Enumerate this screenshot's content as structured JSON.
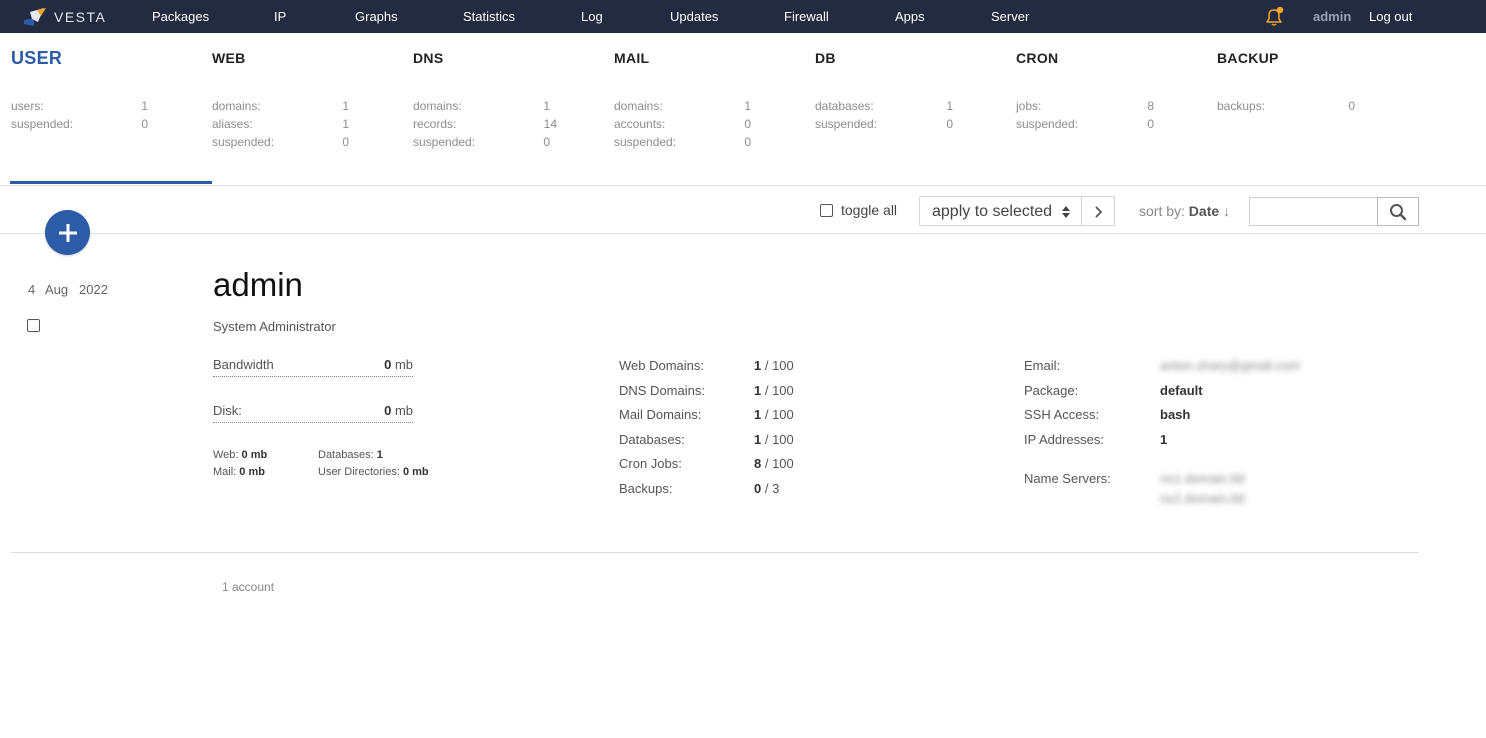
{
  "nav": {
    "logo": "VESTA",
    "items": [
      "Packages",
      "IP",
      "Graphs",
      "Statistics",
      "Log",
      "Updates",
      "Firewall",
      "Apps",
      "Server"
    ],
    "user": "admin",
    "logout": "Log out"
  },
  "stats": [
    {
      "title": "USER",
      "rows": [
        {
          "label": "users:",
          "value": "1"
        },
        {
          "label": "suspended:",
          "value": "0"
        }
      ]
    },
    {
      "title": "WEB",
      "rows": [
        {
          "label": "domains:",
          "value": "1"
        },
        {
          "label": "aliases:",
          "value": "1"
        },
        {
          "label": "suspended:",
          "value": "0"
        }
      ]
    },
    {
      "title": "DNS",
      "rows": [
        {
          "label": "domains:",
          "value": "1"
        },
        {
          "label": "records:",
          "value": "14"
        },
        {
          "label": "suspended:",
          "value": "0"
        }
      ]
    },
    {
      "title": "MAIL",
      "rows": [
        {
          "label": "domains:",
          "value": "1"
        },
        {
          "label": "accounts:",
          "value": "0"
        },
        {
          "label": "suspended:",
          "value": "0"
        }
      ]
    },
    {
      "title": "DB",
      "rows": [
        {
          "label": "databases:",
          "value": "1"
        },
        {
          "label": "suspended:",
          "value": "0"
        }
      ]
    },
    {
      "title": "CRON",
      "rows": [
        {
          "label": "jobs:",
          "value": "8"
        },
        {
          "label": "suspended:",
          "value": "0"
        }
      ]
    },
    {
      "title": "BACKUP",
      "rows": [
        {
          "label": "backups:",
          "value": "0"
        }
      ]
    }
  ],
  "toolbar": {
    "toggle_all": "toggle all",
    "apply": "apply to selected",
    "sort_prefix": "sort by:",
    "sort_field": "Date",
    "sort_arrow": "↓"
  },
  "record": {
    "day": "4",
    "month": "Aug",
    "year": "2022",
    "name": "admin",
    "role": "System Administrator",
    "bandwidth_label": "Bandwidth",
    "bandwidth_value": "0",
    "disk_label": "Disk:",
    "disk_value": "0",
    "unit": "mb",
    "web_label": "Web:",
    "web_value": "0 mb",
    "mail_label": "Mail:",
    "mail_value": "0 mb",
    "db_label": "Databases:",
    "db_value": "1",
    "udir_label": "User Directories:",
    "udir_value": "0 mb",
    "limits": [
      {
        "label": "Web Domains:",
        "used": "1",
        "max": "100"
      },
      {
        "label": "DNS Domains:",
        "used": "1",
        "max": "100"
      },
      {
        "label": "Mail Domains:",
        "used": "1",
        "max": "100"
      },
      {
        "label": "Databases:",
        "used": "1",
        "max": "100"
      },
      {
        "label": "Cron Jobs:",
        "used": "8",
        "max": "100"
      },
      {
        "label": "Backups:",
        "used": "0",
        "max": "3"
      }
    ],
    "email_label": "Email:",
    "email_value": "anton.shary@gmail.com",
    "package_label": "Package:",
    "package_value": "default",
    "ssh_label": "SSH Access:",
    "ssh_value": "bash",
    "ip_label": "IP Addresses:",
    "ip_value": "1",
    "ns_label": "Name Servers:",
    "ns1": "ns1.domain.tld",
    "ns2": "ns2.domain.tld"
  },
  "footer": "1 account",
  "colors": {
    "nav_bg": "#222b3f",
    "accent": "#2c5ba8",
    "bell": "#f5a623"
  }
}
